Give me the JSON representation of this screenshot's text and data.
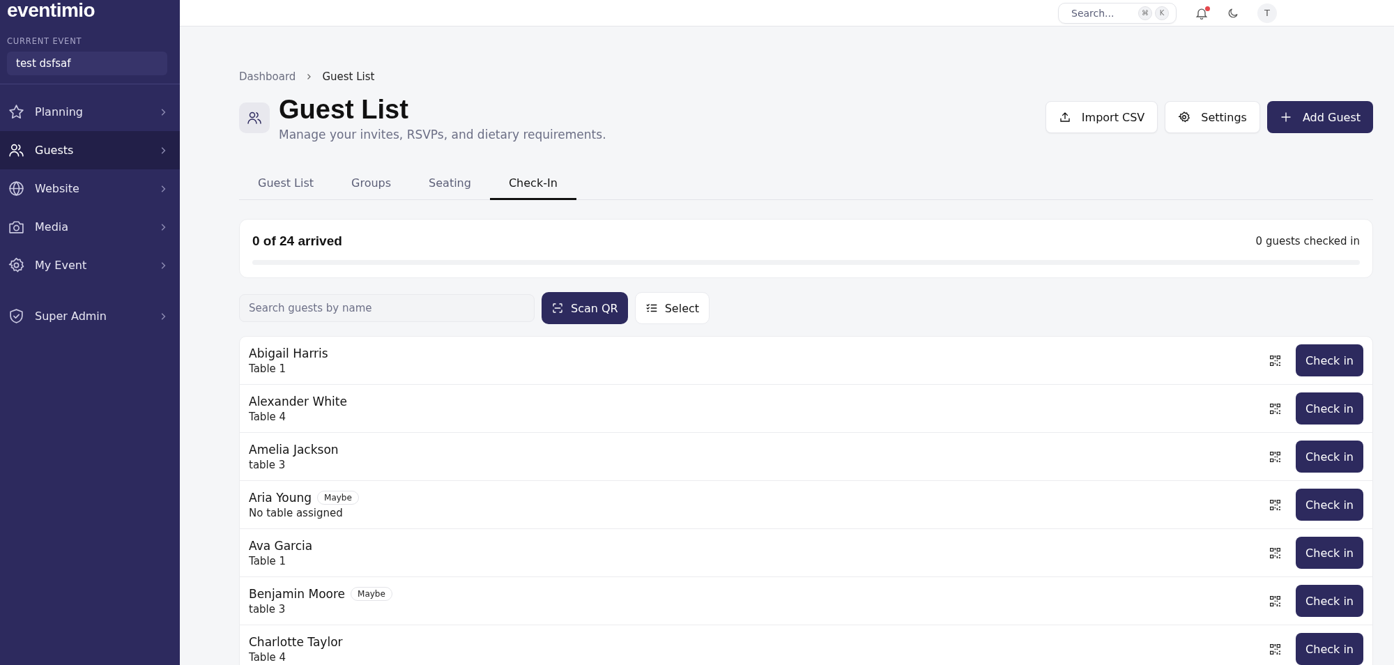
{
  "sidebar": {
    "logo": "eventimio",
    "current_event_label": "CURRENT EVENT",
    "current_event": "test dsfsaf",
    "items": [
      {
        "label": "Planning",
        "selected": false
      },
      {
        "label": "Guests",
        "selected": true
      },
      {
        "label": "Website",
        "selected": false
      },
      {
        "label": "Media",
        "selected": false
      },
      {
        "label": "My Event",
        "selected": false
      },
      {
        "label": "Super Admin",
        "selected": false
      }
    ]
  },
  "top_bar": {
    "search": {
      "placeholder": "Search...",
      "keys": [
        "⌘",
        "K"
      ]
    },
    "notification_dot": true,
    "avatar": "T"
  },
  "breadcrumb": [
    "Dashboard",
    "Guest List"
  ],
  "header": {
    "title": "Guest List",
    "subtitle": "Manage your invites, RSVPs, and dietary requirements.",
    "actions": [
      {
        "label": "Import CSV",
        "kind": "secondary"
      },
      {
        "label": "Settings",
        "kind": "secondary"
      },
      {
        "label": "Add Guest",
        "kind": "primary"
      }
    ]
  },
  "tabs": [
    {
      "label": "Guest List",
      "selected": false
    },
    {
      "label": "Groups",
      "selected": false
    },
    {
      "label": "Seating",
      "selected": false
    },
    {
      "label": "Check-In",
      "selected": true
    }
  ],
  "summary": {
    "arrived": "0 of 24 arrived",
    "checked_in": "0 guests checked in",
    "level": 0
  },
  "search": {
    "placeholder": "Search guests by name"
  },
  "toolbar": [
    {
      "label": "Scan QR",
      "kind": "primary"
    },
    {
      "label": "Select",
      "kind": "secondary"
    }
  ],
  "guests": [
    {
      "name": "Abigail Harris",
      "table": "Table 1",
      "action": "Check in"
    },
    {
      "name": "Alexander White",
      "table": "Table 4",
      "action": "Check in"
    },
    {
      "name": "Amelia Jackson",
      "table": "table 3",
      "action": "Check in"
    },
    {
      "name": "Aria Young",
      "badge": "Maybe",
      "table": "No table assigned",
      "action": "Check in"
    },
    {
      "name": "Ava Garcia",
      "table": "Table 1",
      "action": "Check in"
    },
    {
      "name": "Benjamin Moore",
      "badge": "Maybe",
      "table": "table 3",
      "action": "Check in"
    },
    {
      "name": "Charlotte Taylor",
      "table": "Table 4",
      "action": "Check in"
    }
  ]
}
